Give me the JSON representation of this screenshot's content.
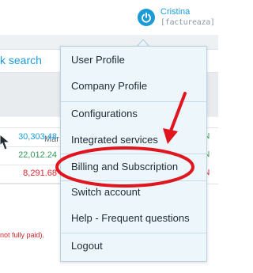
{
  "header": {
    "user_name": "Cristina",
    "user_company": "[factureaza]",
    "avatar_icon": "power-icon",
    "accent_color": "#1a9bd7"
  },
  "background": {
    "search_link": "k search",
    "column_header": "Mar",
    "right_column_header": "D",
    "amounts": [
      {
        "value": "30,303.48",
        "color": "#1a9bd7"
      },
      {
        "value": "22,012.24",
        "color": "#2f9b58"
      },
      {
        "value": "8,291.68",
        "color": "#d9262e"
      }
    ],
    "right_marks": [
      "N",
      "N",
      "N"
    ],
    "note": "not fully paid)."
  },
  "menu": {
    "items": [
      {
        "label": "User Profile"
      },
      {
        "label": "Company Profile"
      },
      {
        "label": "Configurations"
      },
      {
        "label": "Integrated services"
      },
      {
        "label": "Billing and Subscription"
      },
      {
        "label": "Switch account"
      },
      {
        "label": "Help - Frequent questions"
      },
      {
        "label": "Logout"
      }
    ]
  },
  "annotation": {
    "color": "#e0161e"
  }
}
